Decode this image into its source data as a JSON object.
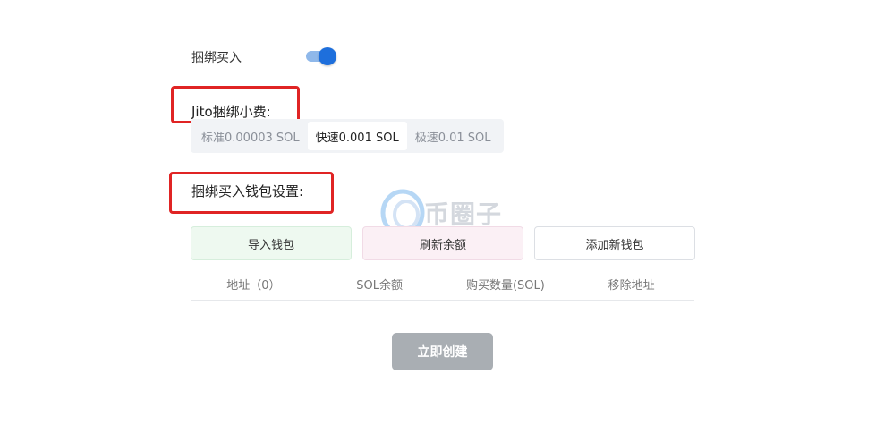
{
  "bundle_buy": {
    "label": "捆绑买入",
    "toggle_on": true
  },
  "jito_tip": {
    "label": "Jito捆绑小费:",
    "options": [
      {
        "label": "标准0.00003 SOL",
        "active": false
      },
      {
        "label": "快速0.001 SOL",
        "active": true
      },
      {
        "label": "极速0.01 SOL",
        "active": false
      }
    ]
  },
  "wallet_settings": {
    "label": "捆绑买入钱包设置:"
  },
  "watermark": {
    "text": "币圈子"
  },
  "buttons": {
    "import": "导入钱包",
    "refresh": "刷新余额",
    "add": "添加新钱包"
  },
  "table": {
    "headers": [
      "地址（0）",
      "SOL余额",
      "购买数量(SOL)",
      "移除地址"
    ]
  },
  "submit": {
    "label": "立即创建"
  },
  "colors": {
    "accent": "#1e6fdc",
    "highlight_box": "#e02424",
    "submit_disabled": "#a9aeb3"
  }
}
